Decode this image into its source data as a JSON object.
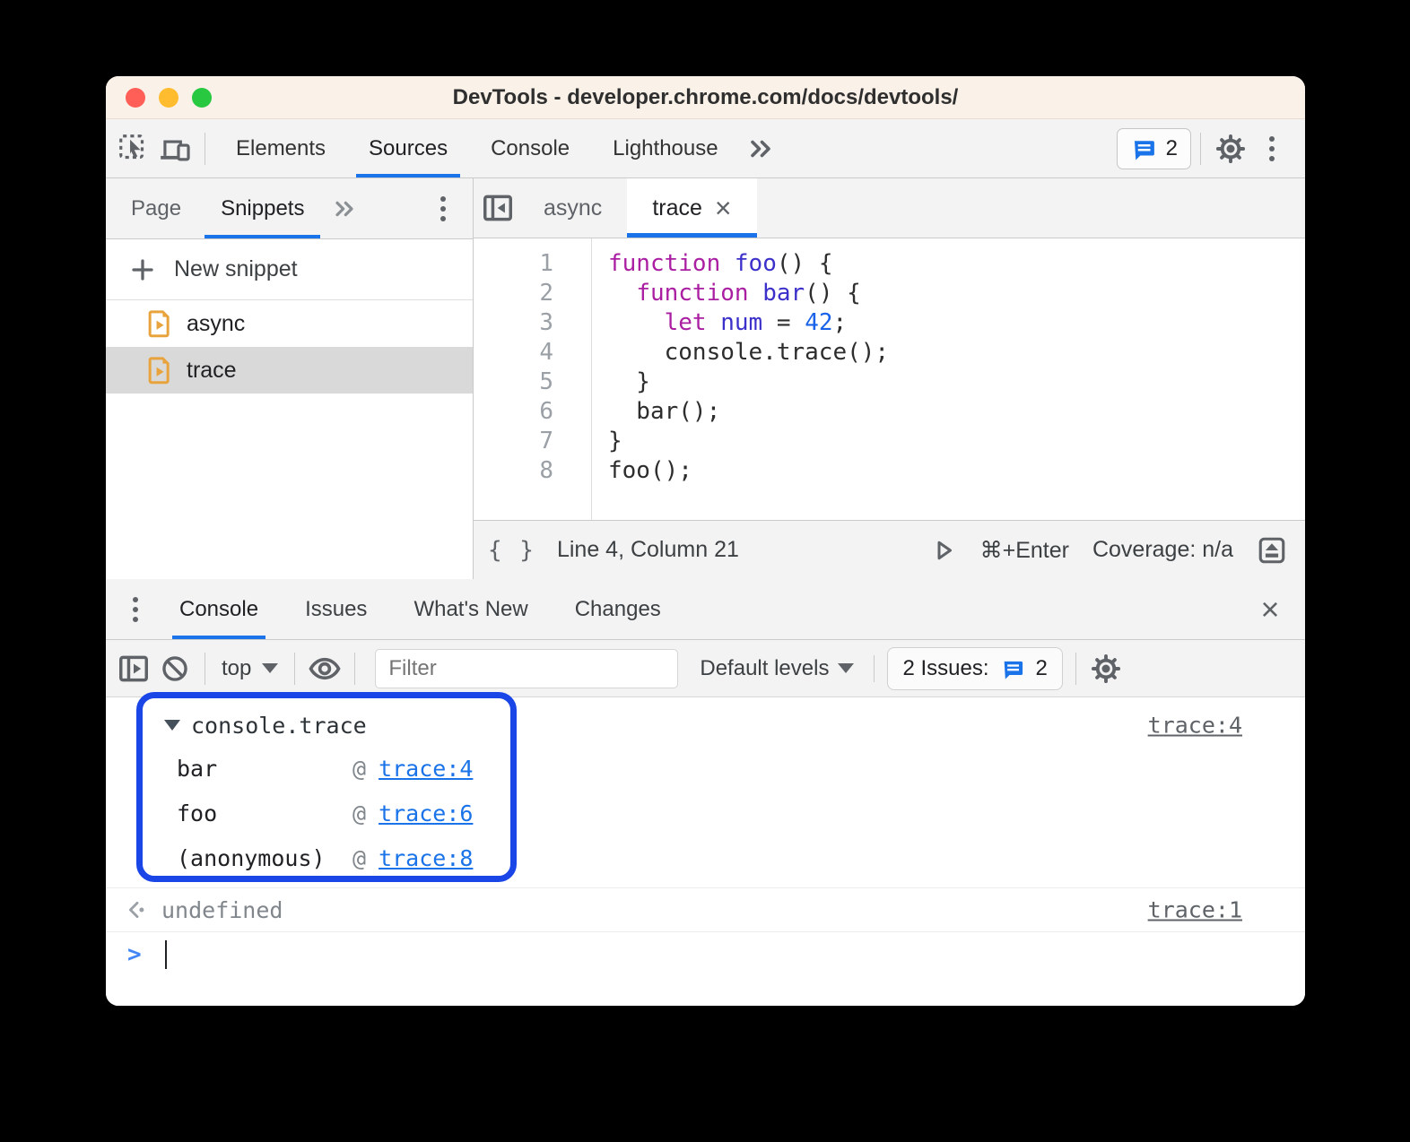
{
  "titlebar": {
    "title": "DevTools - developer.chrome.com/docs/devtools/"
  },
  "toolbar": {
    "tabs": [
      {
        "label": "Elements",
        "active": false
      },
      {
        "label": "Sources",
        "active": true
      },
      {
        "label": "Console",
        "active": false
      },
      {
        "label": "Lighthouse",
        "active": false
      }
    ],
    "issues_badge_count": "2"
  },
  "sidebar": {
    "tabs": [
      {
        "label": "Page",
        "active": false
      },
      {
        "label": "Snippets",
        "active": true
      }
    ],
    "new_snippet_label": "New snippet",
    "plus_glyph": "+",
    "files": [
      {
        "name": "async",
        "selected": false
      },
      {
        "name": "trace",
        "selected": true
      }
    ]
  },
  "editor": {
    "tabs": [
      {
        "label": "async",
        "active": false,
        "closable": false
      },
      {
        "label": "trace",
        "active": true,
        "closable": true
      }
    ],
    "close_glyph": "×",
    "code": [
      [
        {
          "c": "kw",
          "t": "function"
        },
        {
          "c": "pl",
          "t": " "
        },
        {
          "c": "def",
          "t": "foo"
        },
        {
          "c": "pl",
          "t": "() {"
        }
      ],
      [
        {
          "c": "pl",
          "t": "  "
        },
        {
          "c": "kw",
          "t": "function"
        },
        {
          "c": "pl",
          "t": " "
        },
        {
          "c": "def",
          "t": "bar"
        },
        {
          "c": "pl",
          "t": "() {"
        }
      ],
      [
        {
          "c": "pl",
          "t": "    "
        },
        {
          "c": "kw",
          "t": "let"
        },
        {
          "c": "pl",
          "t": " "
        },
        {
          "c": "def",
          "t": "num"
        },
        {
          "c": "pl",
          "t": " = "
        },
        {
          "c": "num",
          "t": "42"
        },
        {
          "c": "pl",
          "t": ";"
        }
      ],
      [
        {
          "c": "pl",
          "t": "    console.trace();"
        }
      ],
      [
        {
          "c": "pl",
          "t": "  }"
        }
      ],
      [
        {
          "c": "pl",
          "t": "  bar();"
        }
      ],
      [
        {
          "c": "pl",
          "t": "}"
        }
      ],
      [
        {
          "c": "pl",
          "t": "foo();"
        }
      ]
    ],
    "status": {
      "braces_glyph": "{ }",
      "line_col": "Line 4, Column 21",
      "shortcut": "⌘+Enter",
      "coverage": "Coverage: n/a"
    }
  },
  "drawer": {
    "tabs": [
      {
        "label": "Console",
        "active": true
      },
      {
        "label": "Issues",
        "active": false
      },
      {
        "label": "What's New",
        "active": false
      },
      {
        "label": "Changes",
        "active": false
      }
    ],
    "close_glyph": "×"
  },
  "console_toolbar": {
    "context": "top",
    "filter_placeholder": "Filter",
    "levels_label": "Default levels",
    "issues_label": "2 Issues:",
    "issues_count": "2"
  },
  "console": {
    "trace_group": {
      "label": "console.trace",
      "source_link": "trace:4",
      "frames": [
        {
          "fn": "bar",
          "sep": "@",
          "link": "trace:4"
        },
        {
          "fn": "foo",
          "sep": "@",
          "link": "trace:6"
        },
        {
          "fn": "(anonymous)",
          "sep": "@",
          "link": "trace:8"
        }
      ]
    },
    "result": {
      "value": "undefined",
      "source_link": "trace:1"
    },
    "prompt_glyph": ">"
  },
  "colors": {
    "accent_blue": "#1a73e8",
    "annotation_blue": "#1a46e8",
    "titlebar_cream": "#faf1e8",
    "toolbar_gray": "#f3f3f3",
    "keyword": "#aa1fa2",
    "definition": "#3b30c9",
    "number": "#1a63e8",
    "snippet_icon_orange": "#e8a33d",
    "prompt_blue": "#4285f4"
  }
}
